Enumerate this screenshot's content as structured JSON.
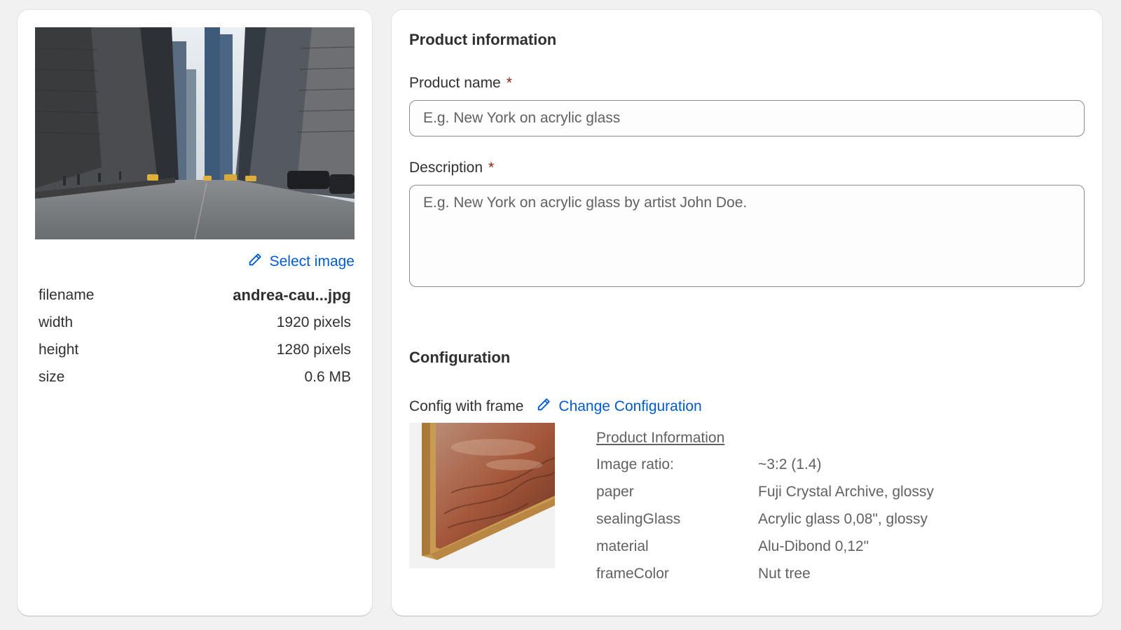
{
  "left_panel": {
    "image_alt": "New York street photo",
    "select_image_label": "Select image",
    "meta": [
      {
        "key": "filename",
        "value": "andrea-cau...jpg"
      },
      {
        "key": "width",
        "value": "1920 pixels"
      },
      {
        "key": "height",
        "value": "1280 pixels"
      },
      {
        "key": "size",
        "value": "0.6 MB"
      }
    ]
  },
  "product_info": {
    "title": "Product information",
    "name_label": "Product name",
    "name_placeholder": "E.g. New York on acrylic glass",
    "description_label": "Description",
    "description_placeholder": "E.g. New York on acrylic glass by artist John Doe.",
    "required_mark": "*"
  },
  "configuration": {
    "title": "Configuration",
    "config_name": "Config with frame",
    "change_label": "Change Configuration",
    "info_link": "Product Information",
    "specs": [
      {
        "key": "Image ratio:",
        "value": "~3:2 (1.4)"
      },
      {
        "key": "paper",
        "value": "Fuji Crystal Archive, glossy"
      },
      {
        "key": "sealingGlass",
        "value": "Acrylic glass 0,08\", glossy"
      },
      {
        "key": "material",
        "value": "Alu-Dibond 0,12\""
      },
      {
        "key": "frameColor",
        "value": "Nut tree"
      }
    ]
  },
  "colors": {
    "accent": "#005bd3",
    "required": "#8e1f0b",
    "background": "#f1f1f1",
    "muted_text": "#616161"
  },
  "icons": {
    "select_image": "pencil-icon",
    "change_configuration": "pencil-icon"
  }
}
